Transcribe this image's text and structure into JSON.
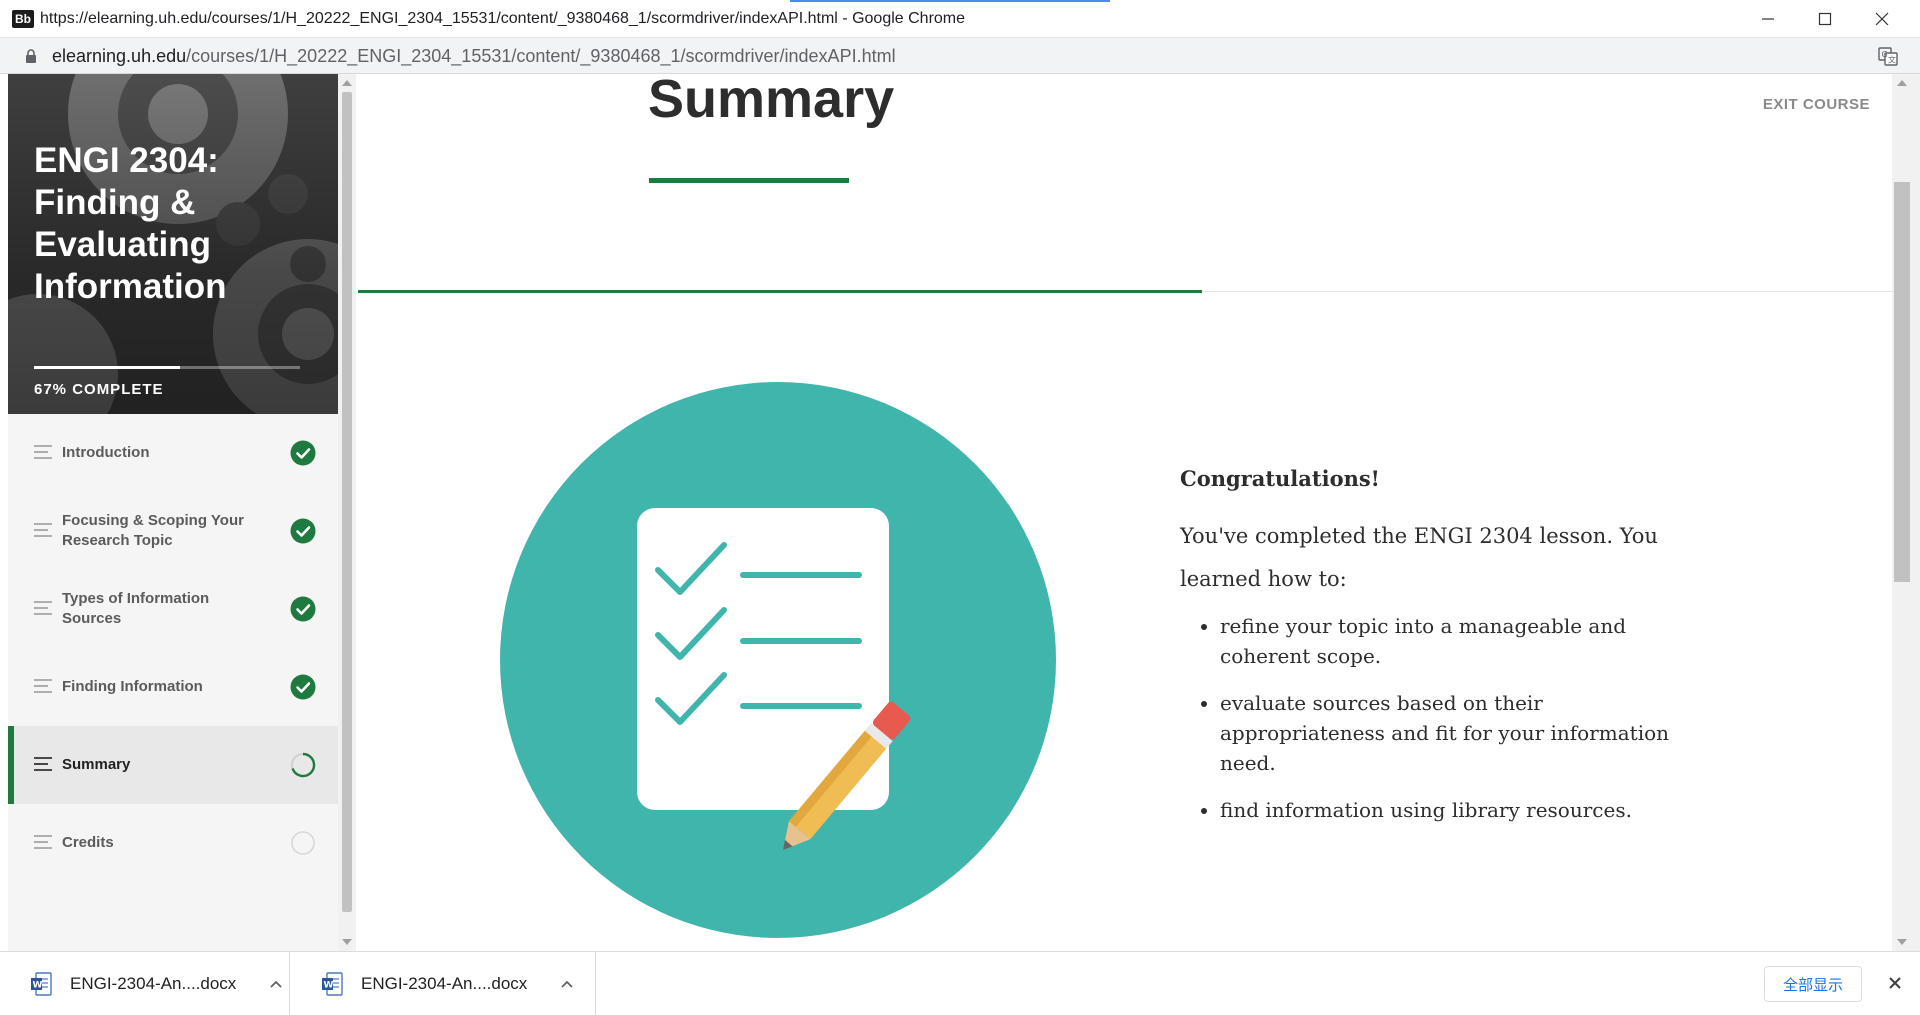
{
  "window": {
    "logo_text": "Bb",
    "title": "https://elearning.uh.edu/courses/1/H_20222_ENGI_2304_15531/content/_9380468_1/scormdriver/indexAPI.html - Google Chrome"
  },
  "address_bar": {
    "domain": "elearning.uh.edu",
    "path": "/courses/1/H_20222_ENGI_2304_15531/content/_9380468_1/scormdriver/indexAPI.html"
  },
  "sidebar": {
    "course_title": "ENGI 2304: Finding & Evaluating Information",
    "progress_text": "67% COMPLETE",
    "progress_fraction": 0.55,
    "lessons": [
      {
        "label": "Introduction",
        "status": "complete"
      },
      {
        "label": "Focusing & Scoping Your Research Topic",
        "status": "complete"
      },
      {
        "label": "Types of Information Sources",
        "status": "complete"
      },
      {
        "label": "Finding Information",
        "status": "complete"
      },
      {
        "label": "Summary",
        "status": "in-progress",
        "active": true
      },
      {
        "label": "Credits",
        "status": "not-started"
      }
    ]
  },
  "main": {
    "title": "Summary",
    "exit_label": "EXIT COURSE",
    "page_progress_fraction": 0.55,
    "congrats_heading": "Congratulations!",
    "congrats_body": "You've completed the ENGI 2304 lesson. You learned how to:",
    "objectives": [
      "refine your topic into a manageable and coherent scope.",
      "evaluate sources based on their appropriateness and fit for your information need.",
      "find information using library resources."
    ]
  },
  "downloads": {
    "items": [
      {
        "name": "ENGI-2304-An....docx",
        "icon": "word-doc-icon"
      },
      {
        "name": "ENGI-2304-An....docx",
        "icon": "word-doc-icon"
      }
    ],
    "show_all_label": "全部显示"
  },
  "colors": {
    "accent_green": "#1f7a3f",
    "illustration_teal": "#40b5ac",
    "link_blue": "#1a73e8"
  }
}
